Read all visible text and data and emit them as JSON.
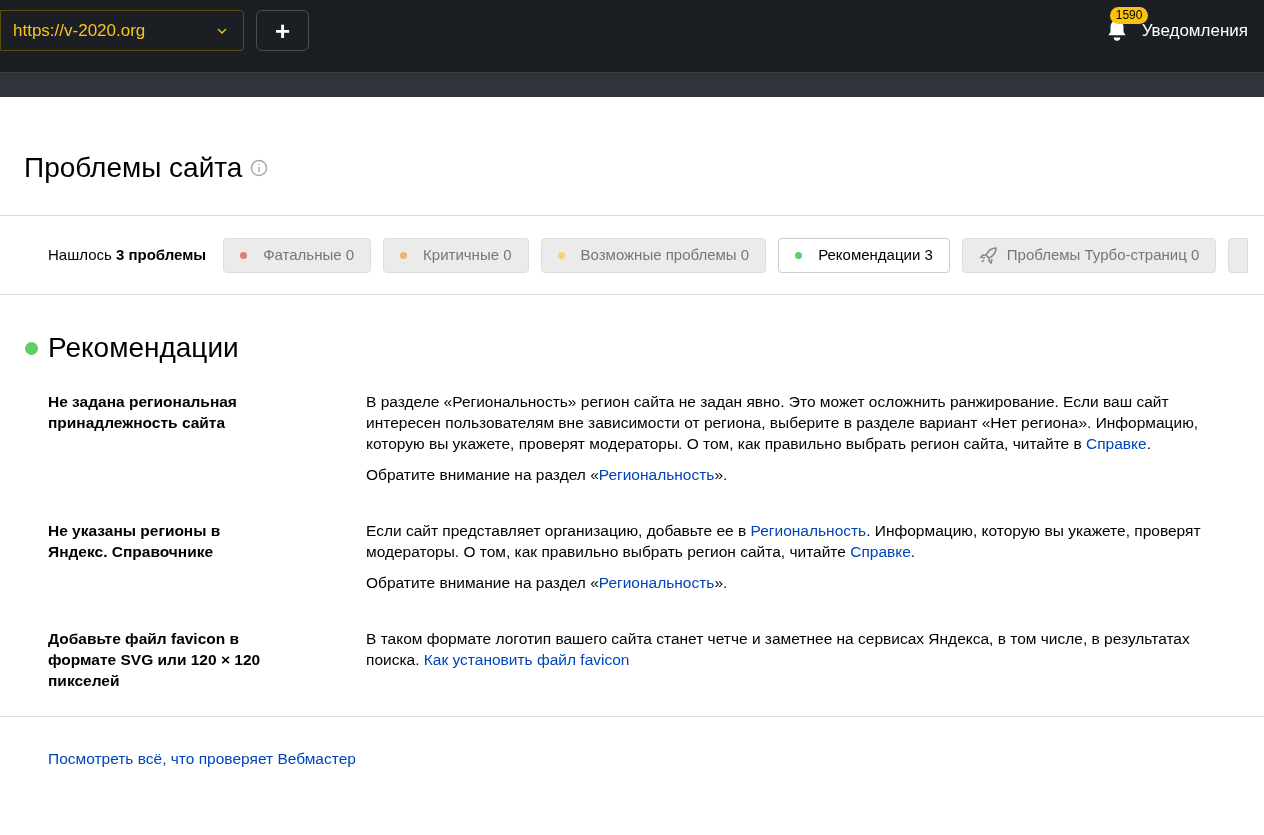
{
  "header": {
    "site_select": {
      "value": "https://v-2020.org"
    },
    "add_button": {
      "label": "+"
    },
    "notifications": {
      "count": "1590",
      "label": "Уведомления"
    }
  },
  "page_title": "Проблемы сайта",
  "filters": {
    "summary": "Нашлось **3 проблемы**",
    "items": [
      {
        "kind": "dot",
        "color": "#e07b7b",
        "label": "Фатальные",
        "count": "0",
        "selected": false
      },
      {
        "kind": "dot",
        "color": "#f0b46e",
        "label": "Критичные",
        "count": "0",
        "selected": false
      },
      {
        "kind": "dot",
        "color": "#f2d66b",
        "label": "Возможные проблемы",
        "count": "0",
        "selected": false
      },
      {
        "kind": "dot",
        "color": "#5ccf6a",
        "label": "Рекомендации",
        "count": "3",
        "selected": true
      },
      {
        "kind": "rocket",
        "label": "Проблемы Турбо-страниц",
        "count": "0",
        "selected": false
      },
      {
        "kind": "cut",
        "selected": false
      }
    ]
  },
  "section": {
    "title": "Рекомендации",
    "color": "#5ccf6a",
    "problems": [
      {
        "title": "Не задана региональная принадлежность сайта",
        "paragraphs": [
          [
            {
              "text": "В разделе «Региональность» регион сайта не задан явно. Это может осложнить ранжирование. Если ваш сайт интересен пользователям вне зависимости от региона, выберите в разделе вариант «Нет региона». Информацию, которую вы укажете, проверят модераторы. О том, как правильно выбрать регион сайта, читайте в "
            },
            {
              "link": "Справке"
            },
            {
              "text": "."
            }
          ],
          [
            {
              "text": "Обратите внимание на раздел «"
            },
            {
              "link": "Региональность"
            },
            {
              "text": "»."
            }
          ]
        ]
      },
      {
        "title": "Не указаны регионы в Яндекс. Справочнике",
        "paragraphs": [
          [
            {
              "text": "Если сайт представляет организацию, добавьте ее в "
            },
            {
              "link": "Региональность"
            },
            {
              "text": ". Информацию, которую вы укажете, проверят модераторы. О том, как правильно выбрать регион сайта, читайте "
            },
            {
              "link": "Справке"
            },
            {
              "text": "."
            }
          ],
          [
            {
              "text": "Обратите внимание на раздел «"
            },
            {
              "link": "Региональность"
            },
            {
              "text": "»."
            }
          ]
        ]
      },
      {
        "title": "Добавьте файл favicon в формате SVG или 120 × 120 пикселей",
        "paragraphs": [
          [
            {
              "text": "В таком формате логотип вашего сайта станет четче и заметнее на сервисах Яндекса, в том числе, в результатах поиска. "
            },
            {
              "link": "Как установить файл favicon"
            }
          ]
        ]
      }
    ]
  },
  "footer_link": "Посмотреть всё, что проверяет Вебмастер"
}
